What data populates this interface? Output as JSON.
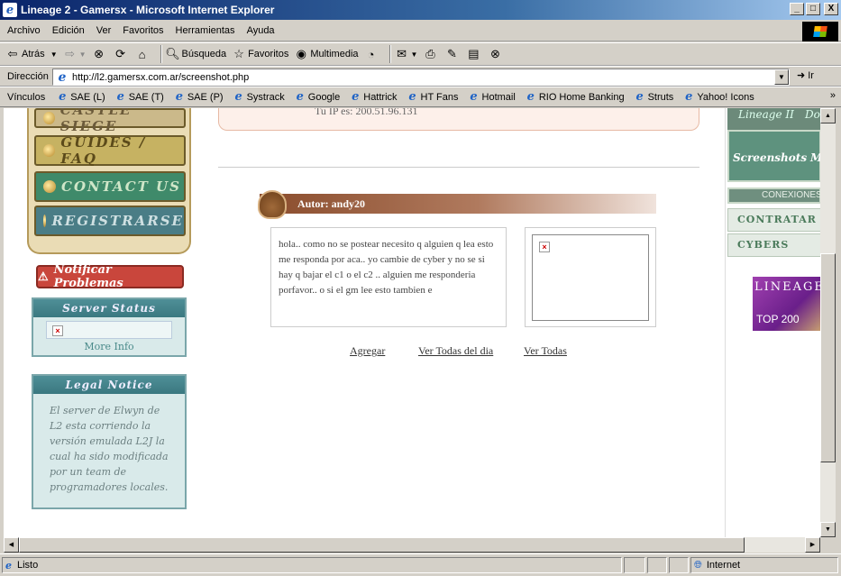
{
  "window": {
    "title": "Lineage 2 - Gamersx - Microsoft Internet Explorer",
    "buttons": {
      "minimize": "_",
      "maximize": "□",
      "close": "X"
    }
  },
  "menu": [
    "Archivo",
    "Edición",
    "Ver",
    "Favoritos",
    "Herramientas",
    "Ayuda"
  ],
  "toolbar": {
    "back": "Atrás",
    "search": "Búsqueda",
    "favorites": "Favoritos",
    "media": "Multimedia"
  },
  "address": {
    "label": "Dirección",
    "url": "http://l2.gamersx.com.ar/screenshot.php",
    "go": "Ir"
  },
  "links": {
    "label": "Vínculos",
    "items": [
      "SAE (L)",
      "SAE (T)",
      "SAE (P)",
      "Systrack",
      "Google",
      "Hattrick",
      "HT Fans",
      "Hotmail",
      "RIO Home Banking",
      "Struts",
      "Yahoo! Icons"
    ],
    "more": "»"
  },
  "page": {
    "nav": [
      "CASTLE SIEGE",
      "GUIDES / FAQ",
      "CONTACT US",
      "REGISTRARSE"
    ],
    "notify": "Notificar Problemas",
    "server_status": {
      "title": "Server Status",
      "more_info": "More Info"
    },
    "legal": {
      "title": "Legal Notice",
      "text": "El server de Elwyn de L2 esta corriendo la versión emulada L2J la cual ha sido modificada por un team de programadores locales."
    },
    "ip": "Tu IP es: 200.51.96.131",
    "author": "Autor: andy20",
    "message": "hola.. como no se postear necesito q alguien q lea esto me responda por aca.. yo cambie de cyber y no se si hay q bajar el c1 o el c2 .. alguien me responderia porfavor.. o si el gm lee esto tambien e",
    "actions": [
      "Agregar",
      "Ver Todas del dia",
      "Ver Todas"
    ],
    "right": {
      "top_left": "Lineage II",
      "top_right": "Dow",
      "screenshots": "Screenshots",
      "screenshots_cut": "M",
      "conexiones": "CONEXIONES",
      "contratar": "CONTRATAR",
      "cybers": "CYBERS",
      "ad_logo": "LINEAGE",
      "ad_top": "TOP 200"
    }
  },
  "status": {
    "text": "Listo",
    "zone": "Internet"
  }
}
